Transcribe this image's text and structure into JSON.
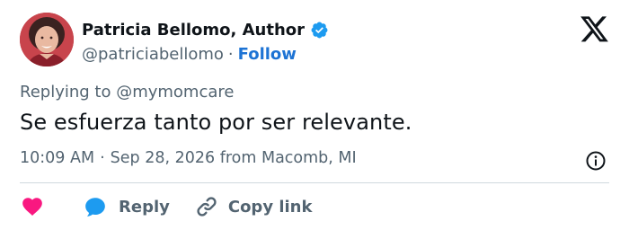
{
  "author": {
    "name": "Patricia Bellomo, Author",
    "handle": "@patriciabellomo",
    "separator": "·",
    "follow_label": "Follow"
  },
  "reply_context": {
    "prefix": "Replying to ",
    "mention": "@mymomcare"
  },
  "tweet": {
    "text": "Se esfuerza tanto por ser relevante."
  },
  "meta": {
    "time": "10:09 AM",
    "separator": "·",
    "date_location": "Sep 28, 2026 from Macomb, MI"
  },
  "actions": {
    "reply_label": "Reply",
    "copy_link_label": "Copy link"
  },
  "colors": {
    "text": "#0f1419",
    "secondary": "#536471",
    "follow": "#1d73d4",
    "verified": "#1d9bf0",
    "heart": "#f91880",
    "reply_bubble": "#1d9bf0",
    "divider": "#cfd9de"
  },
  "icons": {
    "verified": "verified-badge-icon",
    "logo": "x-logo-icon",
    "info": "info-icon",
    "like": "heart-icon",
    "reply": "speech-bubble-icon",
    "copy_link": "link-icon"
  }
}
